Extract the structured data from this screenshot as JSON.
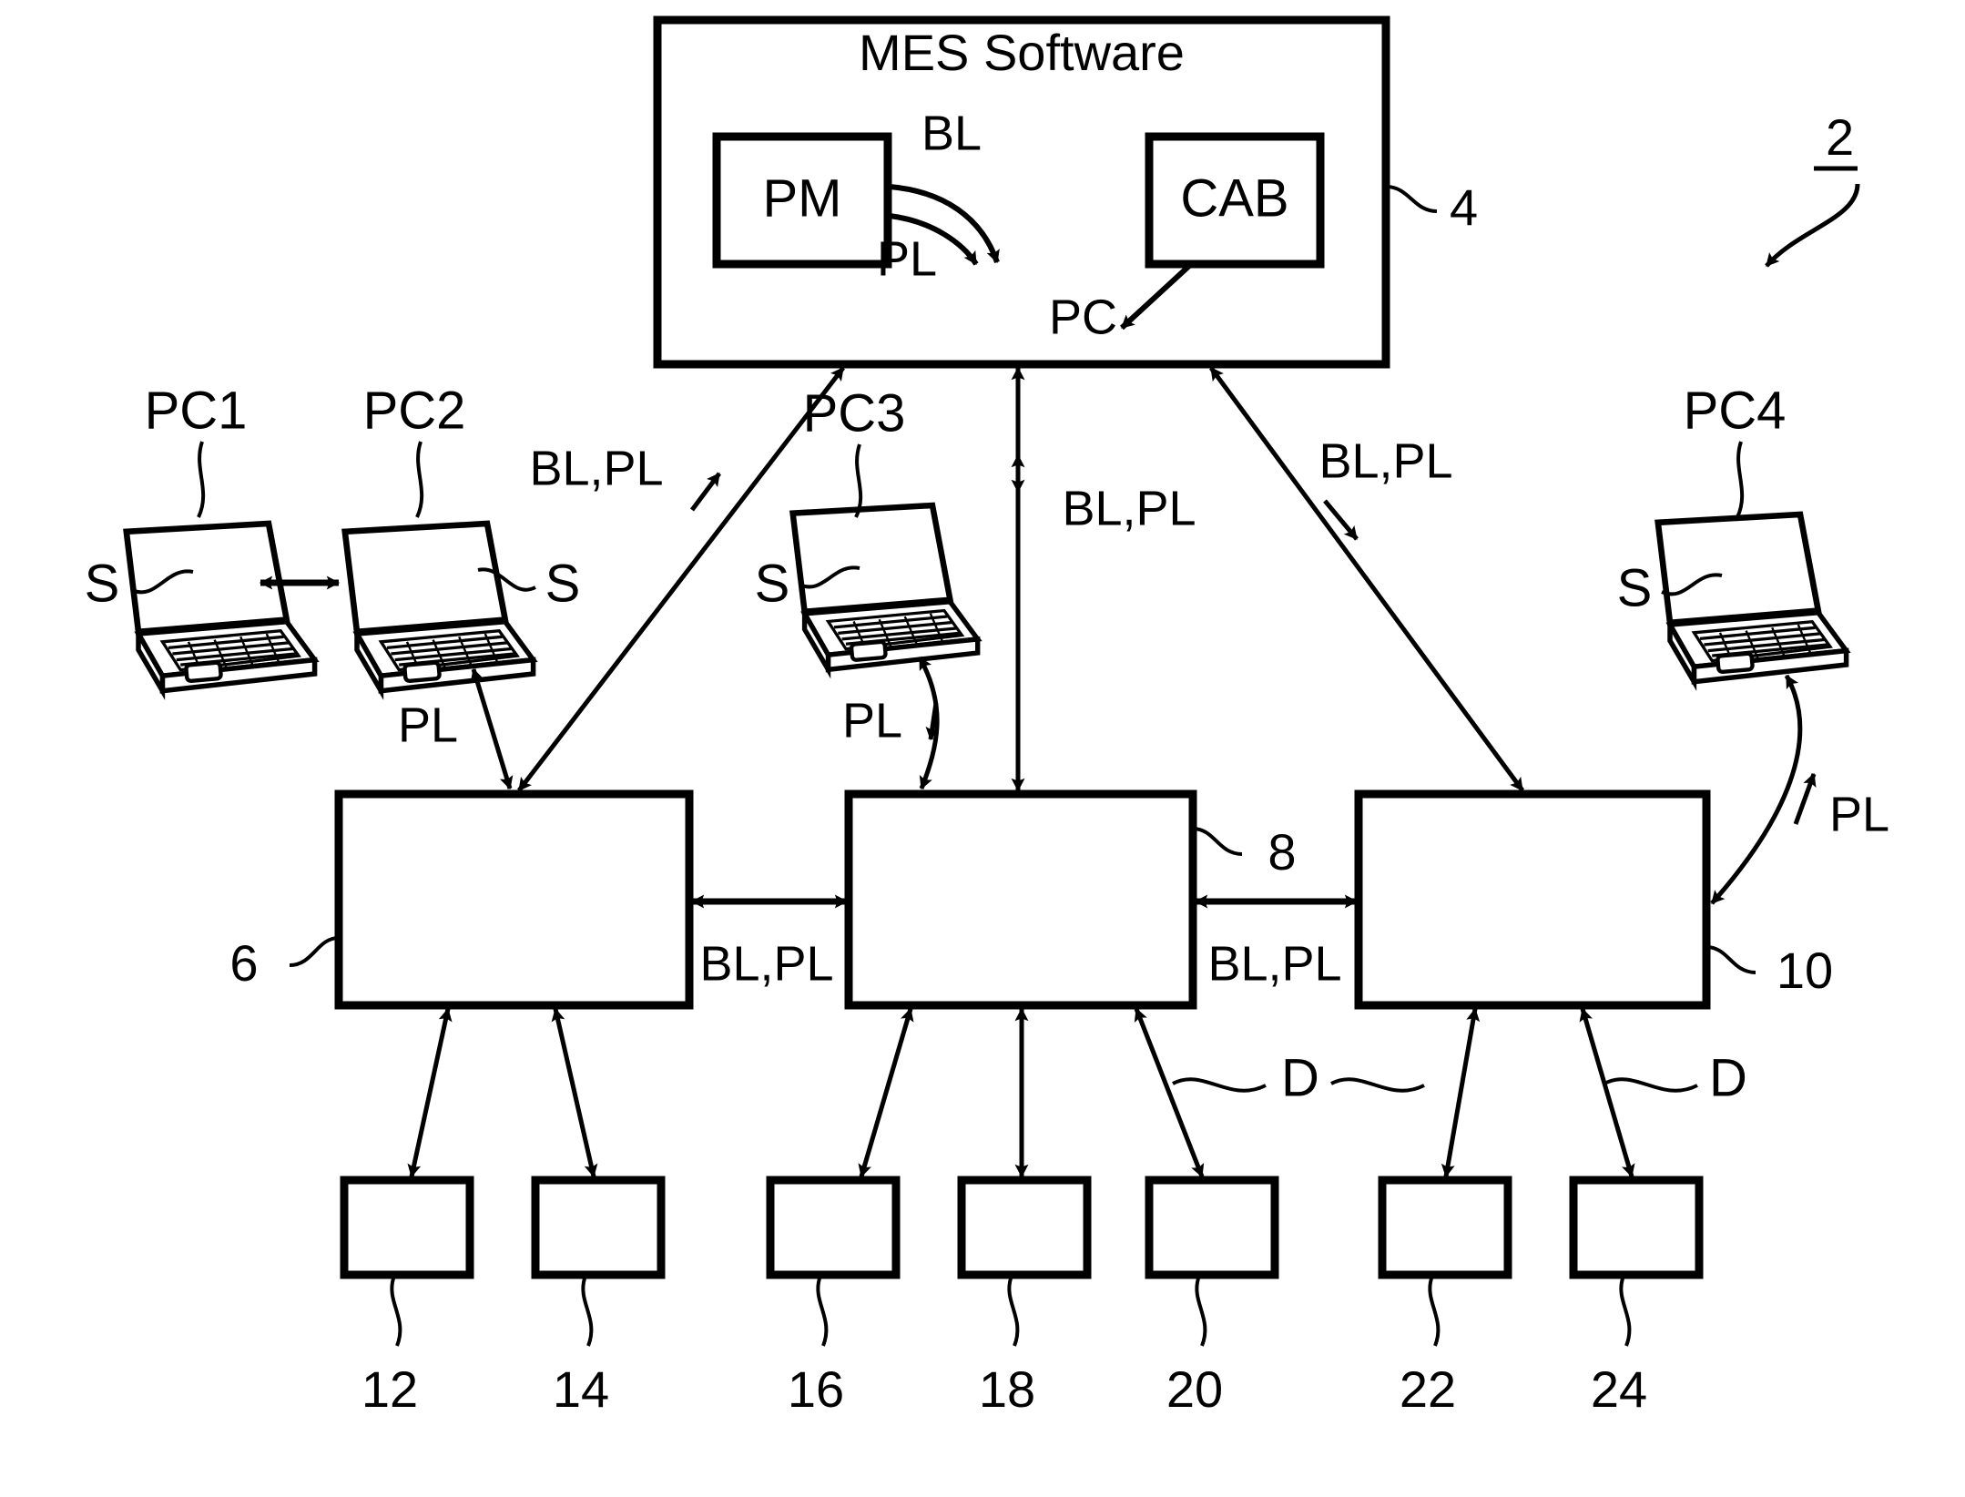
{
  "figure": {
    "title": "MES Software",
    "reference_numeral": "2"
  },
  "mes": {
    "title": "MES Software",
    "ref": "4",
    "modules": [
      {
        "id": "pm",
        "label": "PM"
      },
      {
        "id": "cab",
        "label": "CAB"
      }
    ],
    "internal_flows": [
      {
        "id": "bl",
        "label": "BL"
      },
      {
        "id": "pl",
        "label": "PL"
      },
      {
        "id": "pc",
        "label": "PC"
      }
    ]
  },
  "workstations": [
    {
      "id": "pc1",
      "label": "PC1",
      "signal": "S"
    },
    {
      "id": "pc2",
      "label": "PC2",
      "signal": "S"
    },
    {
      "id": "pc3",
      "label": "PC3",
      "signal": "S"
    },
    {
      "id": "pc4",
      "label": "PC4",
      "signal": "S"
    }
  ],
  "cells": [
    {
      "id": "cell6",
      "ref": "6"
    },
    {
      "id": "cell8",
      "ref": "8"
    },
    {
      "id": "cell10",
      "ref": "10"
    }
  ],
  "machines": [
    {
      "id": "m12",
      "ref": "12"
    },
    {
      "id": "m14",
      "ref": "14"
    },
    {
      "id": "m16",
      "ref": "16"
    },
    {
      "id": "m18",
      "ref": "18"
    },
    {
      "id": "m20",
      "ref": "20"
    },
    {
      "id": "m22",
      "ref": "22"
    },
    {
      "id": "m24",
      "ref": "24"
    }
  ],
  "edge_labels": {
    "mes_to_cell6": "BL,PL",
    "mes_to_cell8": "BL,PL",
    "mes_to_cell10": "BL,PL",
    "cell6_to_cell8": "BL,PL",
    "cell8_to_cell10": "BL,PL",
    "pc2_to_cell6": "PL",
    "pc3_to_cell8": "PL",
    "pc4_to_cell10": "PL",
    "machine_link_1": "D",
    "machine_link_2": "D"
  },
  "colors": {
    "ink": "#000000",
    "paper": "#ffffff"
  }
}
